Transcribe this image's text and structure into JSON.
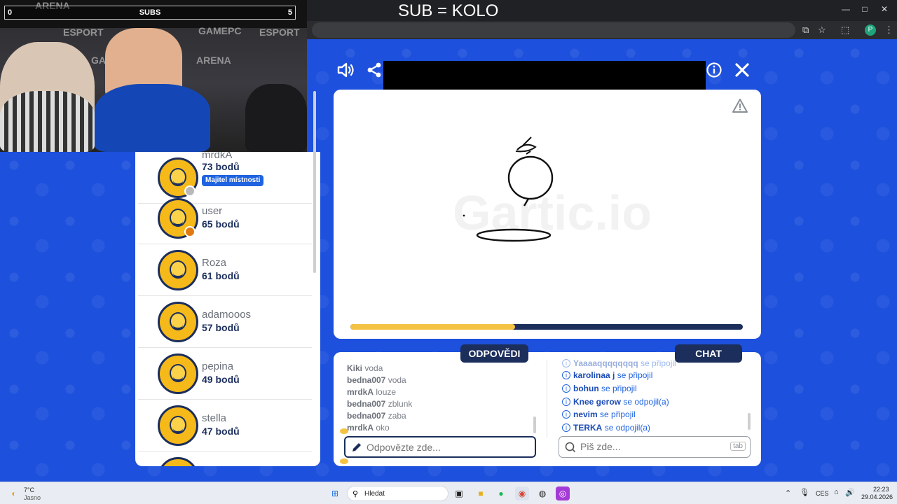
{
  "browser": {
    "stream_title": "SUB = KOLO",
    "window_controls": {
      "minimize": "—",
      "maximize": "□",
      "close": "✕"
    },
    "profile_initial": "P"
  },
  "webcam": {
    "subs_left": "0",
    "subs_label": "SUBS",
    "subs_right": "5",
    "brand_texts": [
      "ARENA",
      "GAMEPC",
      "ESPORT",
      "ARENA",
      "GAMEPC"
    ]
  },
  "players": [
    {
      "name": "mrdkA",
      "score": "73 bodů",
      "badge": "Majitel místnosti",
      "status_color": "#b9b9b9"
    },
    {
      "name": "user",
      "score": "65 bodů",
      "status_color": "#e07b12"
    },
    {
      "name": "Roza",
      "score": "61 bodů"
    },
    {
      "name": "adamooos",
      "score": "57 bodů"
    },
    {
      "name": "pepina",
      "score": "49 bodů"
    },
    {
      "name": "stella",
      "score": "47 bodů"
    }
  ],
  "tabs": {
    "answers": "ODPOVĚDI",
    "chat": "CHAT"
  },
  "answers": [
    {
      "user": "Kiki",
      "text": "voda"
    },
    {
      "user": "bedna007",
      "text": "voda"
    },
    {
      "user": "mrdkA",
      "text": "louze"
    },
    {
      "user": "bedna007",
      "text": "zblunk"
    },
    {
      "user": "bedna007",
      "text": "zaba"
    },
    {
      "user": "mrdkA",
      "text": "oko"
    }
  ],
  "chat": [
    {
      "user": "Yaaaaqqqqqqqq",
      "text": "se připojil"
    },
    {
      "user": "karolinaa j",
      "text": "se připojil"
    },
    {
      "user": "bohun",
      "text": "se připojil"
    },
    {
      "user": "Knee gerow",
      "text": "se odpojil(a)"
    },
    {
      "user": "nevim",
      "text": "se připojil"
    },
    {
      "user": "TERKA",
      "text": "se odpojil(a)"
    }
  ],
  "inputs": {
    "answer_placeholder": "Odpovězte zde...",
    "chat_placeholder": "Piš zde...",
    "tab_key": "tab"
  },
  "round_progress": 0.42,
  "taskbar": {
    "weather_temp": "7°C",
    "weather_desc": "Jasno",
    "search_label": "Hledat",
    "language": "CES",
    "time": "22:23",
    "date": "29.04.2026"
  },
  "colors": {
    "accent_navy": "#1b2e5c",
    "accent_yellow": "#f5c344",
    "bg_blue": "#1d50dc"
  }
}
